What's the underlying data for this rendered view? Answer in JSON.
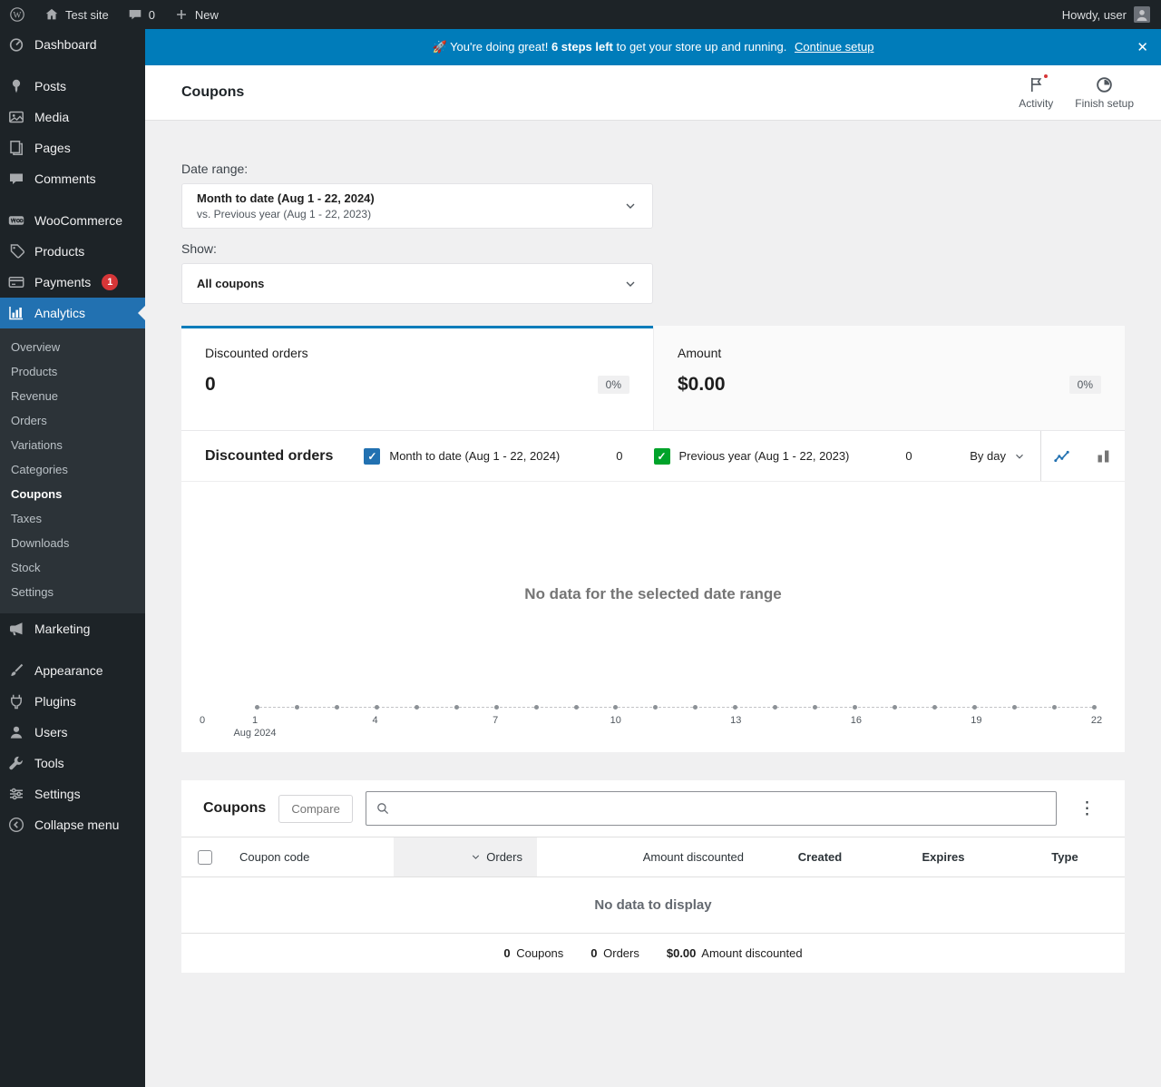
{
  "colors": {
    "banner_blue": "#007cba",
    "wp_blue": "#2271b1",
    "badge_red": "#d63638",
    "sidebar_bg": "#1d2327",
    "content_bg": "#f0f0f1",
    "series_primary": "#2271b1",
    "series_secondary": "#00a32a"
  },
  "admin_bar": {
    "site_name": "Test site",
    "comments_count": "0",
    "new_label": "New",
    "howdy": "Howdy, user"
  },
  "sidebar": {
    "items": [
      {
        "label": "Dashboard",
        "icon": "dashboard"
      },
      {
        "label": "Posts",
        "icon": "posts",
        "group_start": true
      },
      {
        "label": "Media",
        "icon": "media"
      },
      {
        "label": "Pages",
        "icon": "pages"
      },
      {
        "label": "Comments",
        "icon": "comments"
      },
      {
        "label": "WooCommerce",
        "icon": "woo",
        "group_start": true
      },
      {
        "label": "Products",
        "icon": "products"
      },
      {
        "label": "Payments",
        "icon": "payments",
        "badge": "1"
      },
      {
        "label": "Analytics",
        "icon": "analytics",
        "active": true
      },
      {
        "label": "Marketing",
        "icon": "marketing"
      },
      {
        "label": "Appearance",
        "icon": "appearance",
        "group_start": true
      },
      {
        "label": "Plugins",
        "icon": "plugins"
      },
      {
        "label": "Users",
        "icon": "users"
      },
      {
        "label": "Tools",
        "icon": "tools"
      },
      {
        "label": "Settings",
        "icon": "settings"
      }
    ],
    "analytics_submenu": {
      "parent": "Analytics",
      "items": [
        "Overview",
        "Products",
        "Revenue",
        "Orders",
        "Variations",
        "Categories",
        "Coupons",
        "Taxes",
        "Downloads",
        "Stock",
        "Settings"
      ],
      "active": "Coupons"
    },
    "collapse_label": "Collapse menu"
  },
  "banner": {
    "prefix": "🚀 You're doing great!",
    "steps": "6 steps left",
    "suffix": "to get your store up and running.",
    "link": "Continue setup"
  },
  "header": {
    "title": "Coupons",
    "activity_label": "Activity",
    "finish_setup_label": "Finish setup"
  },
  "filters": {
    "date_range_label": "Date range:",
    "date_range_value": "Month to date (Aug 1 - 22, 2024)",
    "date_range_compare": "vs. Previous year (Aug 1 - 22, 2023)",
    "show_label": "Show:",
    "show_value": "All coupons"
  },
  "summary_cards": [
    {
      "label": "Discounted orders",
      "value": "0",
      "delta": "0%",
      "selected": true
    },
    {
      "label": "Amount",
      "value": "$0.00",
      "delta": "0%",
      "selected": false
    }
  ],
  "chart_data": {
    "type": "line",
    "title": "Discounted orders",
    "interval": "By day",
    "empty_message": "No data for the selected date range",
    "series": [
      {
        "name": "Month to date (Aug 1 - 22, 2024)",
        "total": "0",
        "color": "#2271b1",
        "checked": true,
        "values": [
          0,
          0,
          0,
          0,
          0,
          0,
          0,
          0,
          0,
          0,
          0,
          0,
          0,
          0,
          0,
          0,
          0,
          0,
          0,
          0,
          0,
          0
        ]
      },
      {
        "name": "Previous year (Aug 1 - 22, 2023)",
        "total": "0",
        "color": "#00a32a",
        "checked": true,
        "values": [
          0,
          0,
          0,
          0,
          0,
          0,
          0,
          0,
          0,
          0,
          0,
          0,
          0,
          0,
          0,
          0,
          0,
          0,
          0,
          0,
          0,
          0
        ]
      }
    ],
    "days": 22,
    "x_ticks": [
      1,
      4,
      7,
      10,
      13,
      16,
      19,
      22
    ],
    "x_sublabel": "Aug 2024",
    "y_zero_label": "0",
    "ylim": [
      0,
      1
    ],
    "legend_position": "top",
    "grid": false
  },
  "table": {
    "title": "Coupons",
    "compare_label": "Compare",
    "search_placeholder": "",
    "columns": [
      {
        "label": "Coupon code",
        "align": "left"
      },
      {
        "label": "Orders",
        "align": "right",
        "sorted": "desc"
      },
      {
        "label": "Amount discounted",
        "align": "right"
      },
      {
        "label": "Created",
        "align": "center",
        "bold": true
      },
      {
        "label": "Expires",
        "align": "center",
        "bold": true
      },
      {
        "label": "Type",
        "align": "center",
        "bold": true
      }
    ],
    "empty_message": "No data to display",
    "summary": [
      {
        "value": "0",
        "label": "Coupons"
      },
      {
        "value": "0",
        "label": "Orders"
      },
      {
        "value": "$0.00",
        "label": "Amount discounted"
      }
    ]
  }
}
